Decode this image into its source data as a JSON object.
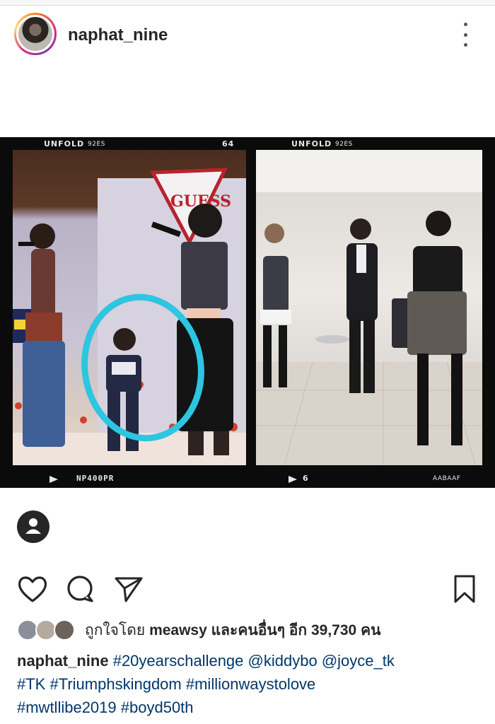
{
  "post": {
    "username": "naphat_nine",
    "more_icon": "more-vertical-icon"
  },
  "photo": {
    "left_frame": {
      "brand": "UNFOLD",
      "brand_code": "92ES",
      "frame_number": "64",
      "film_code": "NP400PR",
      "sign_text": "GUESS"
    },
    "right_frame": {
      "brand": "UNFOLD",
      "brand_code": "92ES",
      "frame_number": "6",
      "film_code": "AABAAF"
    },
    "tag_icon": "user-tag-icon",
    "highlight_color": "#2ec5e0"
  },
  "actions": {
    "like_icon": "heart-icon",
    "comment_icon": "comment-icon",
    "share_icon": "send-icon",
    "save_icon": "bookmark-icon"
  },
  "likes": {
    "prefix": "ถูกใจโดย",
    "first_user": "meawsy",
    "middle": "และคนอื่นๆ อีก",
    "count": "39,730",
    "suffix": "คน"
  },
  "caption": {
    "username": "naphat_nine",
    "tags": [
      "#20yearschallenge",
      "@kiddybo",
      "@joyce_tk",
      "#TK",
      "#Triumphskingdom",
      "#millionwaystolove",
      "#mwtllibe2019",
      "#boyd50th"
    ]
  },
  "colors": {
    "link": "#00376b",
    "text": "#262626"
  }
}
